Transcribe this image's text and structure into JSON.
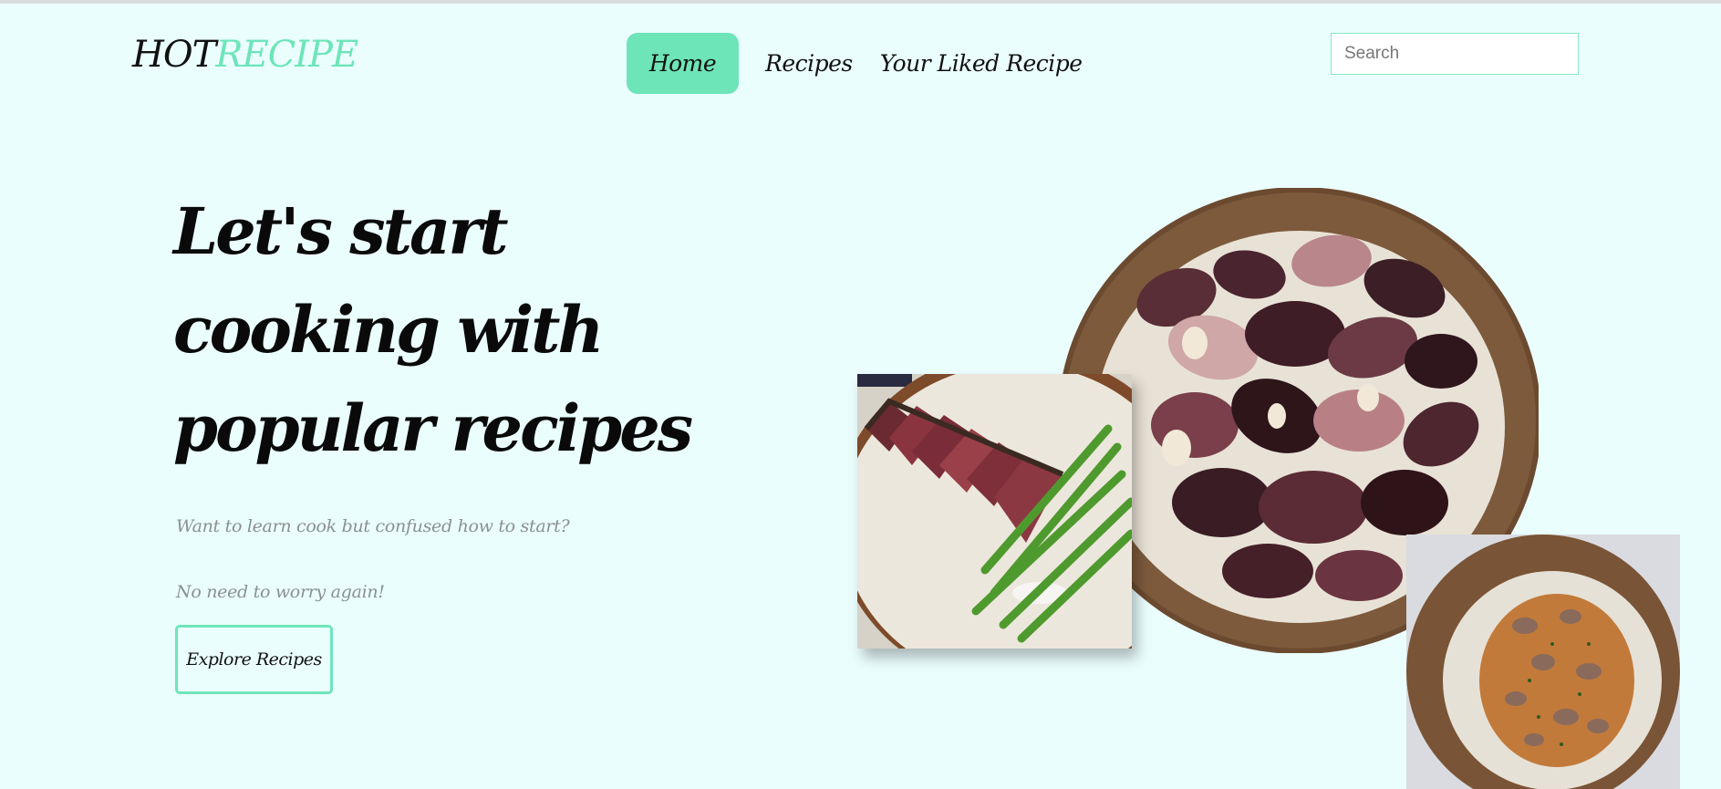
{
  "header": {
    "logo": {
      "part1": "HOT",
      "part2": "RECIPE"
    },
    "nav": [
      {
        "label": "Home",
        "active": true
      },
      {
        "label": "Recipes",
        "active": false
      },
      {
        "label": "Your Liked Recipe",
        "active": false
      }
    ],
    "search": {
      "placeholder": "Search",
      "value": ""
    }
  },
  "hero": {
    "title_lines": [
      "Let's start",
      "cooking with",
      "popular recipes"
    ],
    "subtitle1": "Want to learn cook but confused how to start?",
    "subtitle2": "No need to worry again!",
    "cta_label": "Explore Recipes"
  },
  "colors": {
    "background": "#ebfefe",
    "accent": "#6ee5b9",
    "text": "#111111",
    "muted_text": "#8a9090"
  },
  "images": [
    {
      "icon": "grilled-squid-plate-image"
    },
    {
      "icon": "steak-asparagus-plate-image"
    },
    {
      "icon": "clam-rice-plate-image"
    }
  ]
}
